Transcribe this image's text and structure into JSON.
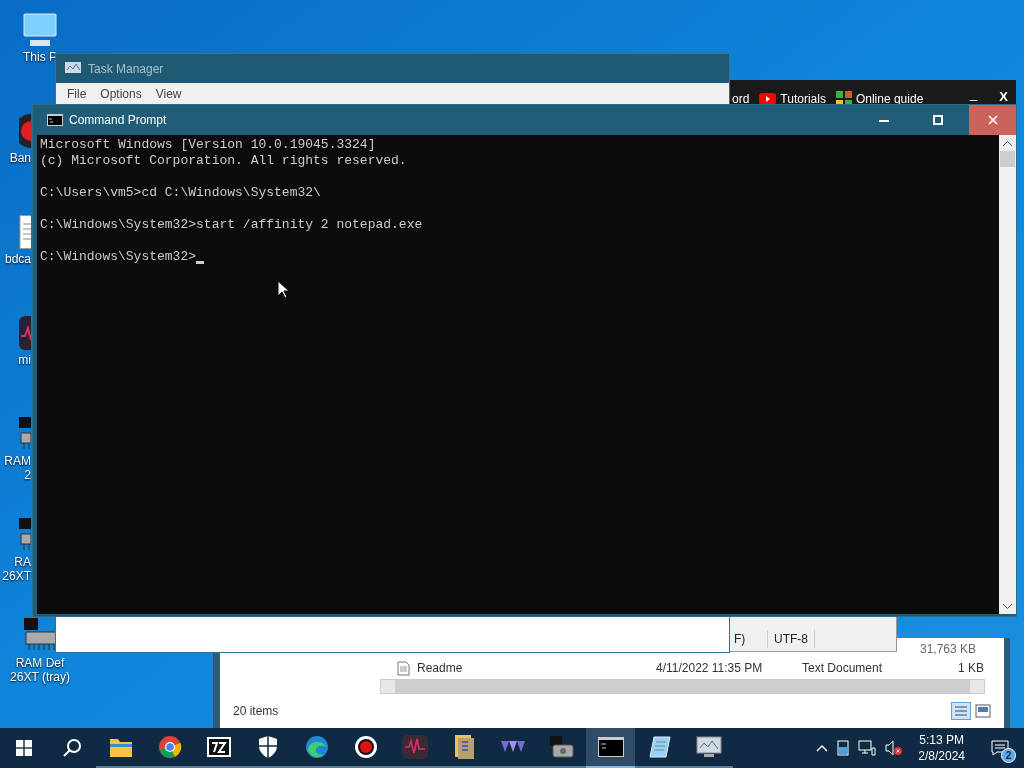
{
  "desktop_icons": [
    {
      "kind": "monitor",
      "lines": [
        "This P"
      ]
    },
    {
      "kind": "bandicam",
      "lines": [
        "Ban"
      ]
    },
    {
      "kind": "document",
      "lines": [
        "bdca"
      ]
    },
    {
      "kind": "wave",
      "lines": [
        "mi"
      ]
    },
    {
      "kind": "ram",
      "lines": [
        "RAM",
        "2"
      ]
    },
    {
      "kind": "ram",
      "lines": [
        "RA",
        "26XT"
      ]
    },
    {
      "kind": "ram",
      "lines": [
        "RAM Def",
        "26XT (tray)"
      ]
    }
  ],
  "task_manager": {
    "title": "Task Manager",
    "menu": [
      "File",
      "Options",
      "View"
    ]
  },
  "background_app": {
    "links": [
      {
        "kind": "plain",
        "label": "ord"
      },
      {
        "kind": "video",
        "label": "Tutorials"
      },
      {
        "kind": "guide",
        "label": "Online guide"
      }
    ],
    "minimize": "_",
    "close": "X"
  },
  "notepad_status": {
    "cells": [
      "F)",
      "UTF-8"
    ]
  },
  "explorer": {
    "size_above": "31,763 KB",
    "rows": [
      {
        "name": "Readme",
        "date": "4/11/2022 11:35 PM",
        "type": "Text Document",
        "size": "1 KB"
      }
    ],
    "status": "20 items"
  },
  "command_prompt": {
    "title": "Command Prompt",
    "lines": [
      {
        "text": "Microsoft Windows [Version 10.0.19045.3324]",
        "blank_after": false
      },
      {
        "text": "(c) Microsoft Corporation. All rights reserved.",
        "blank_after": true
      },
      {
        "text": "C:\\Users\\vm5>cd C:\\Windows\\System32\\",
        "blank_after": true
      },
      {
        "text": "C:\\Windows\\System32>start /affinity 2 notepad.exe",
        "blank_after": true
      },
      {
        "text": "C:\\Windows\\System32>",
        "blank_after": false
      }
    ],
    "cursor": true
  },
  "taskbar": {
    "apps": [
      {
        "kind": "folder",
        "selected": false
      },
      {
        "kind": "chrome",
        "selected": false
      },
      {
        "kind": "sevenzip",
        "selected": false
      },
      {
        "kind": "shield",
        "selected": false
      },
      {
        "kind": "edge",
        "selected": false
      },
      {
        "kind": "record",
        "selected": false
      },
      {
        "kind": "wave",
        "selected": false
      },
      {
        "kind": "archive",
        "selected": false
      },
      {
        "kind": "triangles",
        "selected": false
      },
      {
        "kind": "disk",
        "selected": false
      },
      {
        "kind": "terminal",
        "selected": true
      },
      {
        "kind": "notepad",
        "selected": false
      },
      {
        "kind": "monitor",
        "selected": false
      }
    ],
    "time": "5:13 PM",
    "date": "2/8/2024",
    "notifications": "2"
  }
}
